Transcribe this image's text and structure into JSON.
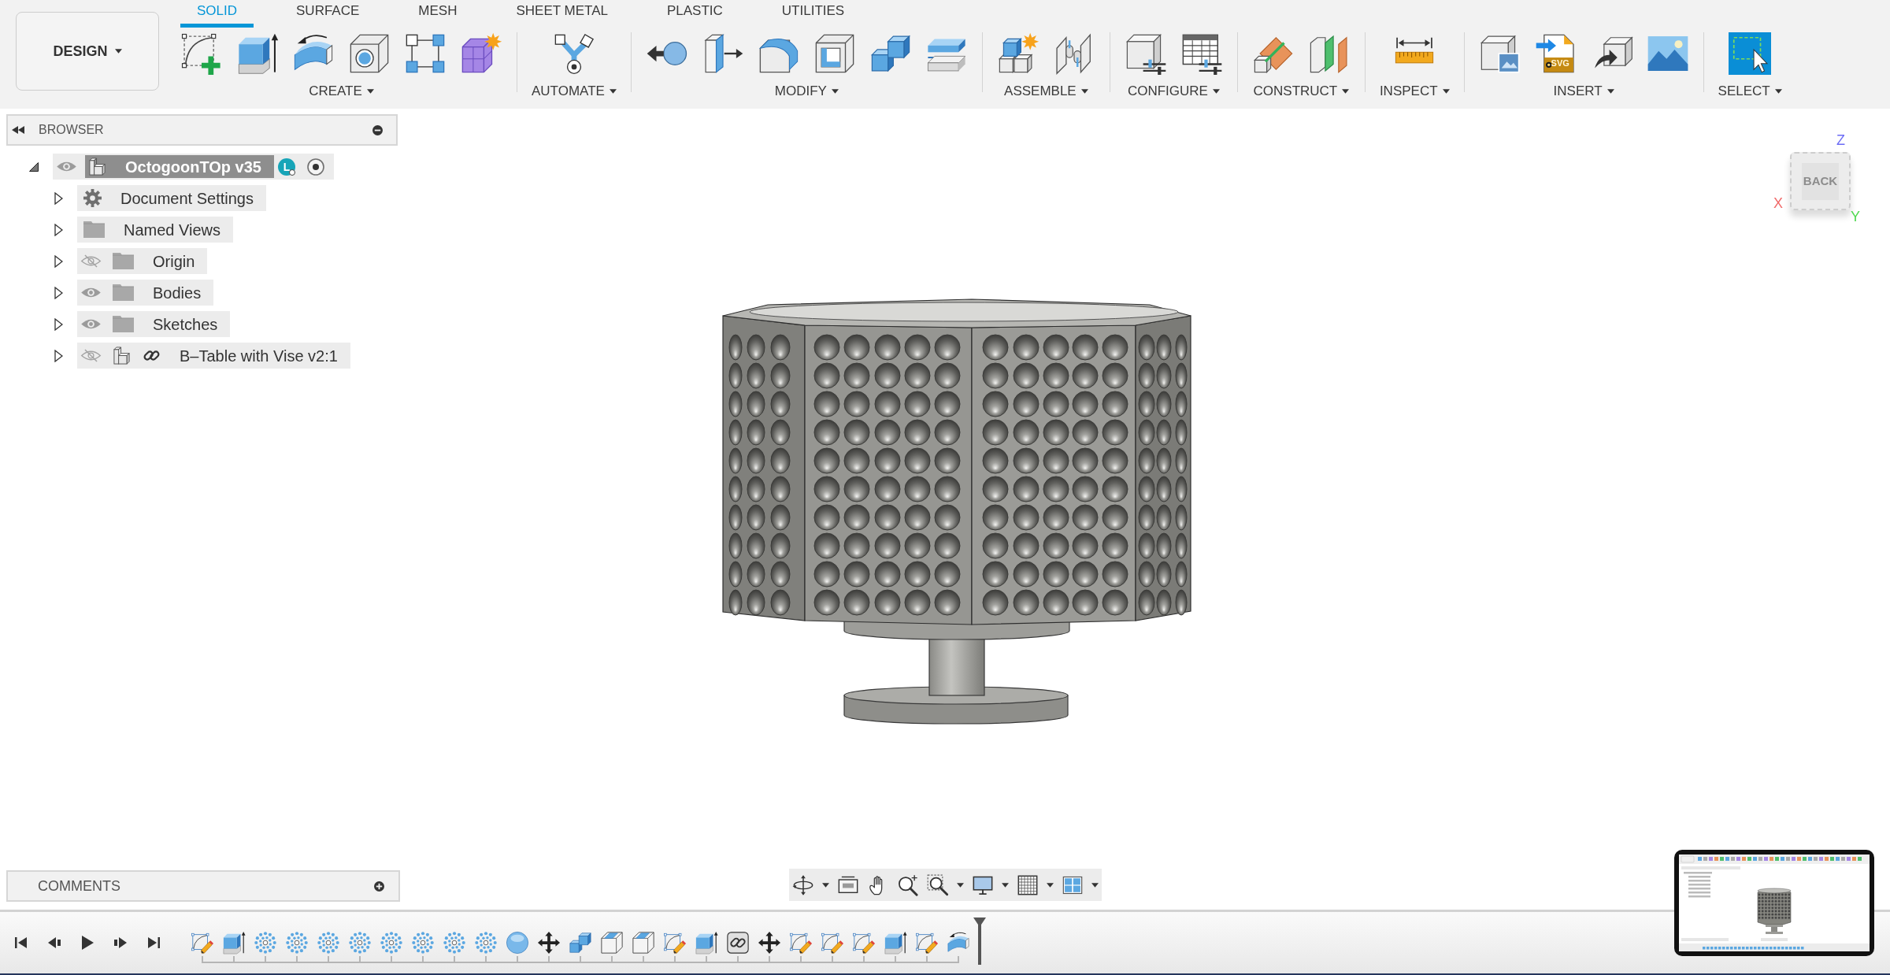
{
  "workspace": {
    "label": "DESIGN"
  },
  "tabs": [
    {
      "label": "SOLID",
      "selected": true
    },
    {
      "label": "SURFACE",
      "selected": false
    },
    {
      "label": "MESH",
      "selected": false
    },
    {
      "label": "SHEET METAL",
      "selected": false
    },
    {
      "label": "PLASTIC",
      "selected": false
    },
    {
      "label": "UTILITIES",
      "selected": false
    }
  ],
  "tool_groups": [
    {
      "label": "CREATE",
      "tools": [
        {
          "kind": "sketch"
        },
        {
          "kind": "extrude"
        },
        {
          "kind": "revolve"
        },
        {
          "kind": "hole"
        },
        {
          "kind": "pattern"
        },
        {
          "kind": "form"
        }
      ]
    },
    {
      "label": "AUTOMATE",
      "tools": [
        {
          "kind": "automate"
        }
      ]
    },
    {
      "label": "MODIFY",
      "tools": [
        {
          "kind": "press_pull"
        },
        {
          "kind": "slab_arrow"
        },
        {
          "kind": "fillet"
        },
        {
          "kind": "shell"
        },
        {
          "kind": "combine"
        },
        {
          "kind": "plates"
        }
      ]
    },
    {
      "label": "ASSEMBLE",
      "tools": [
        {
          "kind": "new_component"
        },
        {
          "kind": "joint"
        }
      ]
    },
    {
      "label": "CONFIGURE",
      "tools": [
        {
          "kind": "cube_sliders"
        },
        {
          "kind": "table_sliders"
        }
      ]
    },
    {
      "label": "CONSTRUCT",
      "tools": [
        {
          "kind": "offset_plane"
        },
        {
          "kind": "planes"
        }
      ]
    },
    {
      "label": "INSPECT",
      "tools": [
        {
          "kind": "measure"
        }
      ]
    },
    {
      "label": "INSERT",
      "tools": [
        {
          "kind": "cube_picture"
        },
        {
          "kind": "svg_file",
          "text": "SVG"
        },
        {
          "kind": "cube_arrow"
        },
        {
          "kind": "picture"
        }
      ]
    },
    {
      "label": "SELECT",
      "tools": [
        {
          "kind": "select"
        }
      ]
    }
  ],
  "browser": {
    "title": "BROWSER",
    "tree": [
      {
        "label": "OctogoonTOp v35",
        "kind": "component",
        "expanded": true,
        "selected": true,
        "visible": true,
        "badge": "L",
        "active": true,
        "children": [
          {
            "label": "Document Settings",
            "kind": "settings",
            "expanded": false,
            "selected": false
          },
          {
            "label": "Named Views",
            "kind": "folder",
            "expanded": false,
            "selected": false
          },
          {
            "label": "Origin",
            "kind": "folder",
            "expanded": false,
            "selected": false,
            "visible": false
          },
          {
            "label": "Bodies",
            "kind": "folder",
            "expanded": false,
            "selected": false,
            "visible": true
          },
          {
            "label": "Sketches",
            "kind": "folder",
            "expanded": false,
            "selected": false,
            "visible": true
          },
          {
            "label": "B–Table with Vise v2:1",
            "kind": "linked_component",
            "expanded": false,
            "selected": false,
            "visible": false
          }
        ]
      }
    ]
  },
  "view_cube": {
    "face": "BACK",
    "axes": [
      {
        "label": "Z",
        "color": "#6c6cf5"
      },
      {
        "label": "X",
        "color": "#f06a6a"
      },
      {
        "label": "Y",
        "color": "#4fd84f"
      }
    ]
  },
  "comments": {
    "title": "COMMENTS"
  },
  "timeline": {
    "features": [
      {
        "kind": "sketch"
      },
      {
        "kind": "extrude"
      },
      {
        "kind": "pattern"
      },
      {
        "kind": "pattern"
      },
      {
        "kind": "pattern"
      },
      {
        "kind": "pattern"
      },
      {
        "kind": "pattern"
      },
      {
        "kind": "pattern"
      },
      {
        "kind": "pattern"
      },
      {
        "kind": "pattern"
      },
      {
        "kind": "sphere"
      },
      {
        "kind": "move"
      },
      {
        "kind": "combine"
      },
      {
        "kind": "chamfer"
      },
      {
        "kind": "chamfer"
      },
      {
        "kind": "sketch"
      },
      {
        "kind": "extrude"
      },
      {
        "kind": "link"
      },
      {
        "kind": "move"
      },
      {
        "kind": "sketch"
      },
      {
        "kind": "sketch"
      },
      {
        "kind": "sketch"
      },
      {
        "kind": "extrude"
      },
      {
        "kind": "sketch"
      },
      {
        "kind": "revolve"
      }
    ]
  }
}
